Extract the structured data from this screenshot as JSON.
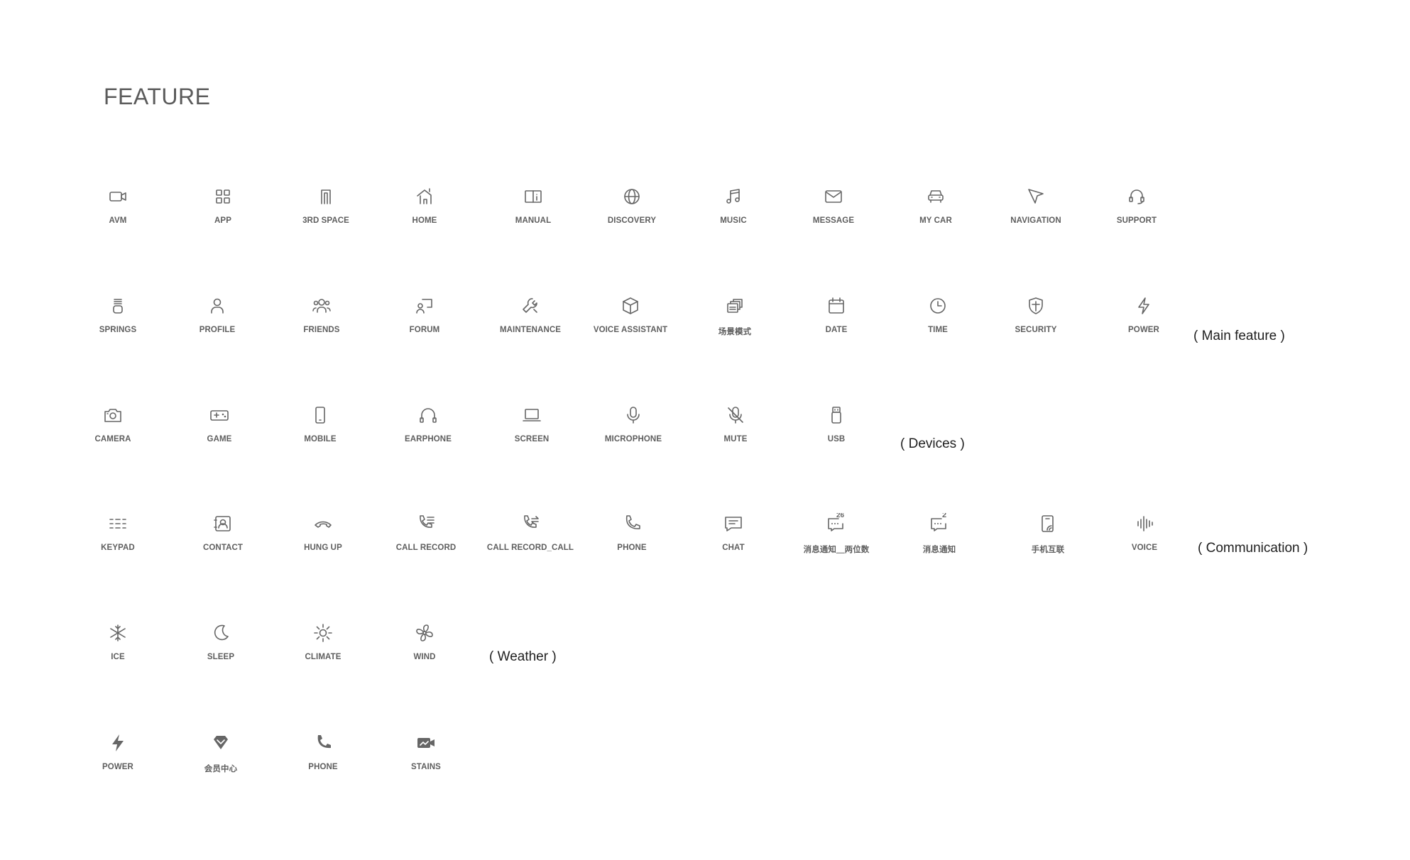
{
  "title": "FEATURE",
  "rows": [
    {
      "group": "",
      "items": [
        {
          "icon": "video-camera-icon",
          "label": "AVM"
        },
        {
          "icon": "app-grid-icon",
          "label": "APP"
        },
        {
          "icon": "third-space-icon",
          "label": "3RD SPACE"
        },
        {
          "icon": "home-icon",
          "label": "HOME"
        },
        {
          "icon": "manual-book-icon",
          "label": "MANUAL"
        },
        {
          "icon": "globe-icon",
          "label": "DISCOVERY"
        },
        {
          "icon": "music-note-icon",
          "label": "MUSIC"
        },
        {
          "icon": "envelope-icon",
          "label": "MESSAGE"
        },
        {
          "icon": "car-icon",
          "label": "MY CAR"
        },
        {
          "icon": "navigation-arrow-icon",
          "label": "NAVIGATION"
        },
        {
          "icon": "headset-icon",
          "label": "SUPPORT"
        }
      ]
    },
    {
      "group": "( Main feature )",
      "items": [
        {
          "icon": "springs-icon",
          "label": "SPRINGS"
        },
        {
          "icon": "user-icon",
          "label": "PROFILE"
        },
        {
          "icon": "friends-icon",
          "label": "FRIENDS"
        },
        {
          "icon": "forum-icon",
          "label": "FORUM"
        },
        {
          "icon": "wrench-icon",
          "label": "MAINTENANCE"
        },
        {
          "icon": "cube-icon",
          "label": "VOICE ASSISTANT"
        },
        {
          "icon": "scene-layers-icon",
          "label": "场景模式"
        },
        {
          "icon": "calendar-icon",
          "label": "DATE"
        },
        {
          "icon": "clock-icon",
          "label": "TIME"
        },
        {
          "icon": "shield-icon",
          "label": "SECURITY"
        },
        {
          "icon": "lightning-icon",
          "label": "POWER"
        }
      ]
    },
    {
      "group": "( Devices )",
      "items": [
        {
          "icon": "camera-icon",
          "label": "CAMERA"
        },
        {
          "icon": "gamepad-icon",
          "label": "GAME"
        },
        {
          "icon": "mobile-icon",
          "label": "MOBILE"
        },
        {
          "icon": "earphone-icon",
          "label": "EARPHONE"
        },
        {
          "icon": "laptop-icon",
          "label": "SCREEN"
        },
        {
          "icon": "microphone-icon",
          "label": "MICROPHONE"
        },
        {
          "icon": "mic-mute-icon",
          "label": "MUTE"
        },
        {
          "icon": "usb-icon",
          "label": "USB"
        }
      ]
    },
    {
      "group": "( Communication )",
      "items": [
        {
          "icon": "keypad-icon",
          "label": "KEYPAD"
        },
        {
          "icon": "contact-card-icon",
          "label": "CONTACT"
        },
        {
          "icon": "hang-up-icon",
          "label": "HUNG UP"
        },
        {
          "icon": "call-record-icon",
          "label": "CALL RECORD"
        },
        {
          "icon": "call-transfer-icon",
          "label": "CALL RECORD_CALL"
        },
        {
          "icon": "phone-icon",
          "label": "PHONE"
        },
        {
          "icon": "chat-bubble-icon",
          "label": "CHAT"
        },
        {
          "icon": "message-badge-icon",
          "label": "消息通知＿两位数",
          "badge": "26"
        },
        {
          "icon": "message-badge-icon",
          "label": "消息通知",
          "badge": "2"
        },
        {
          "icon": "phone-link-icon",
          "label": "手机互联"
        },
        {
          "icon": "voice-wave-icon",
          "label": "VOICE"
        }
      ]
    },
    {
      "group": "( Weather )",
      "items": [
        {
          "icon": "snowflake-icon",
          "label": "ICE"
        },
        {
          "icon": "moon-icon",
          "label": "SLEEP"
        },
        {
          "icon": "sun-icon",
          "label": "CLIMATE"
        },
        {
          "icon": "fan-icon",
          "label": "WIND"
        }
      ]
    },
    {
      "group": "",
      "items": [
        {
          "icon": "lightning-solid-icon",
          "label": "POWER"
        },
        {
          "icon": "diamond-icon",
          "label": "会员中心"
        },
        {
          "icon": "phone-solid-icon",
          "label": "PHONE"
        },
        {
          "icon": "video-solid-icon",
          "label": "STAINS"
        }
      ]
    }
  ]
}
